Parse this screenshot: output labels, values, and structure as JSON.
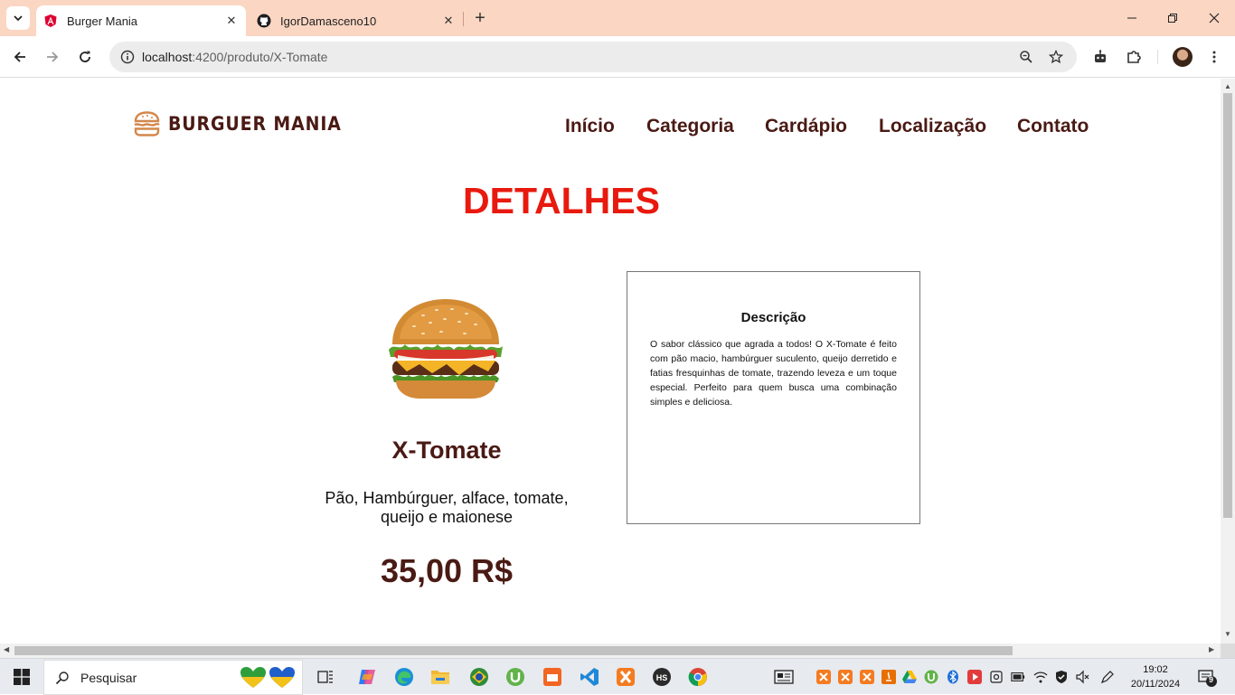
{
  "browser": {
    "tabs": [
      {
        "title": "Burger Mania",
        "icon": "angular-icon",
        "active": true
      },
      {
        "title": "IgorDamasceno10",
        "icon": "github-icon",
        "active": false
      }
    ],
    "url_host": "localhost",
    "url_path": ":4200/produto/X-Tomate"
  },
  "site": {
    "brand": "BURGUER MANIA",
    "nav": [
      "Início",
      "Categoria",
      "Cardápio",
      "Localização",
      "Contato"
    ],
    "page_title": "DETALHES",
    "product": {
      "name": "X-Tomate",
      "ingredients": "Pão, Hambúrguer, alface, tomate, queijo e maionese",
      "price": "35,00 R$",
      "image": "burger-photo"
    },
    "description": {
      "title": "Descrição",
      "text": "O sabor clássico que agrada a todos! O X-Tomate é feito com pão macio, hambúrguer suculento, queijo derretido e fatias fresquinhas de tomate, trazendo leveza e um toque especial. Perfeito para quem busca uma combinação simples e deliciosa."
    }
  },
  "taskbar": {
    "search_placeholder": "Pesquisar",
    "time": "19:02",
    "date": "20/11/2024",
    "notifications": "9"
  },
  "colors": {
    "brand_dark": "#4a1a14",
    "title_red": "#e8190e",
    "tab_strip": "#fbd6c3"
  }
}
